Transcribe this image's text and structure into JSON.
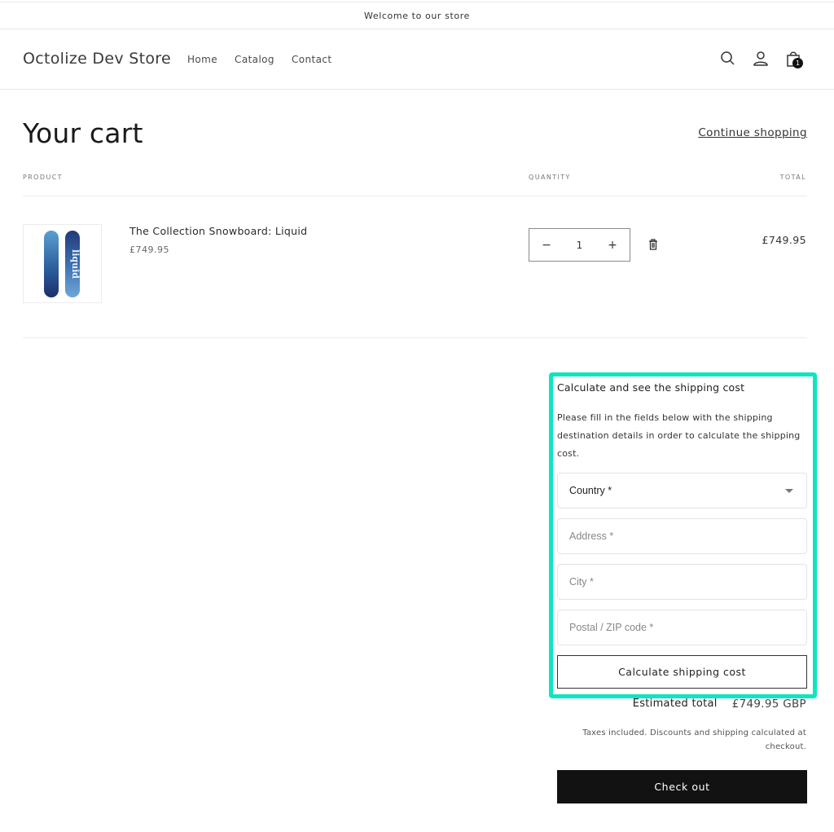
{
  "announcement": "Welcome to our store",
  "header": {
    "logo": "Octolize Dev Store",
    "nav": [
      {
        "label": "Home"
      },
      {
        "label": "Catalog"
      },
      {
        "label": "Contact"
      }
    ],
    "icons": [
      "search-icon",
      "account-icon",
      "cart-icon"
    ],
    "cart_count": "1"
  },
  "cart": {
    "title": "Your cart",
    "continue_label": "Continue shopping",
    "columns": {
      "product": "PRODUCT",
      "quantity": "QUANTITY",
      "total": "TOTAL"
    },
    "items": [
      {
        "name": "The Collection Snowboard: Liquid",
        "price": "£749.95",
        "quantity": "1",
        "total": "£749.95",
        "decrease_label": "−",
        "increase_label": "+"
      }
    ]
  },
  "shipping": {
    "title": "Calculate and see the shipping cost",
    "description": "Please fill in the fields below with the shipping destination details in order to calculate the shipping cost.",
    "country": {
      "value": "Country *"
    },
    "address": {
      "placeholder": "Address *"
    },
    "city": {
      "placeholder": "City *"
    },
    "postal": {
      "placeholder": "Postal / ZIP code *"
    },
    "button": "Calculate shipping cost",
    "highlight_color": "#0de6c0"
  },
  "summary": {
    "estimated_label": "Estimated total",
    "estimated_value": "£749.95 GBP",
    "tax_note": "Taxes included. Discounts and shipping calculated at checkout.",
    "checkout_label": "Check out"
  }
}
